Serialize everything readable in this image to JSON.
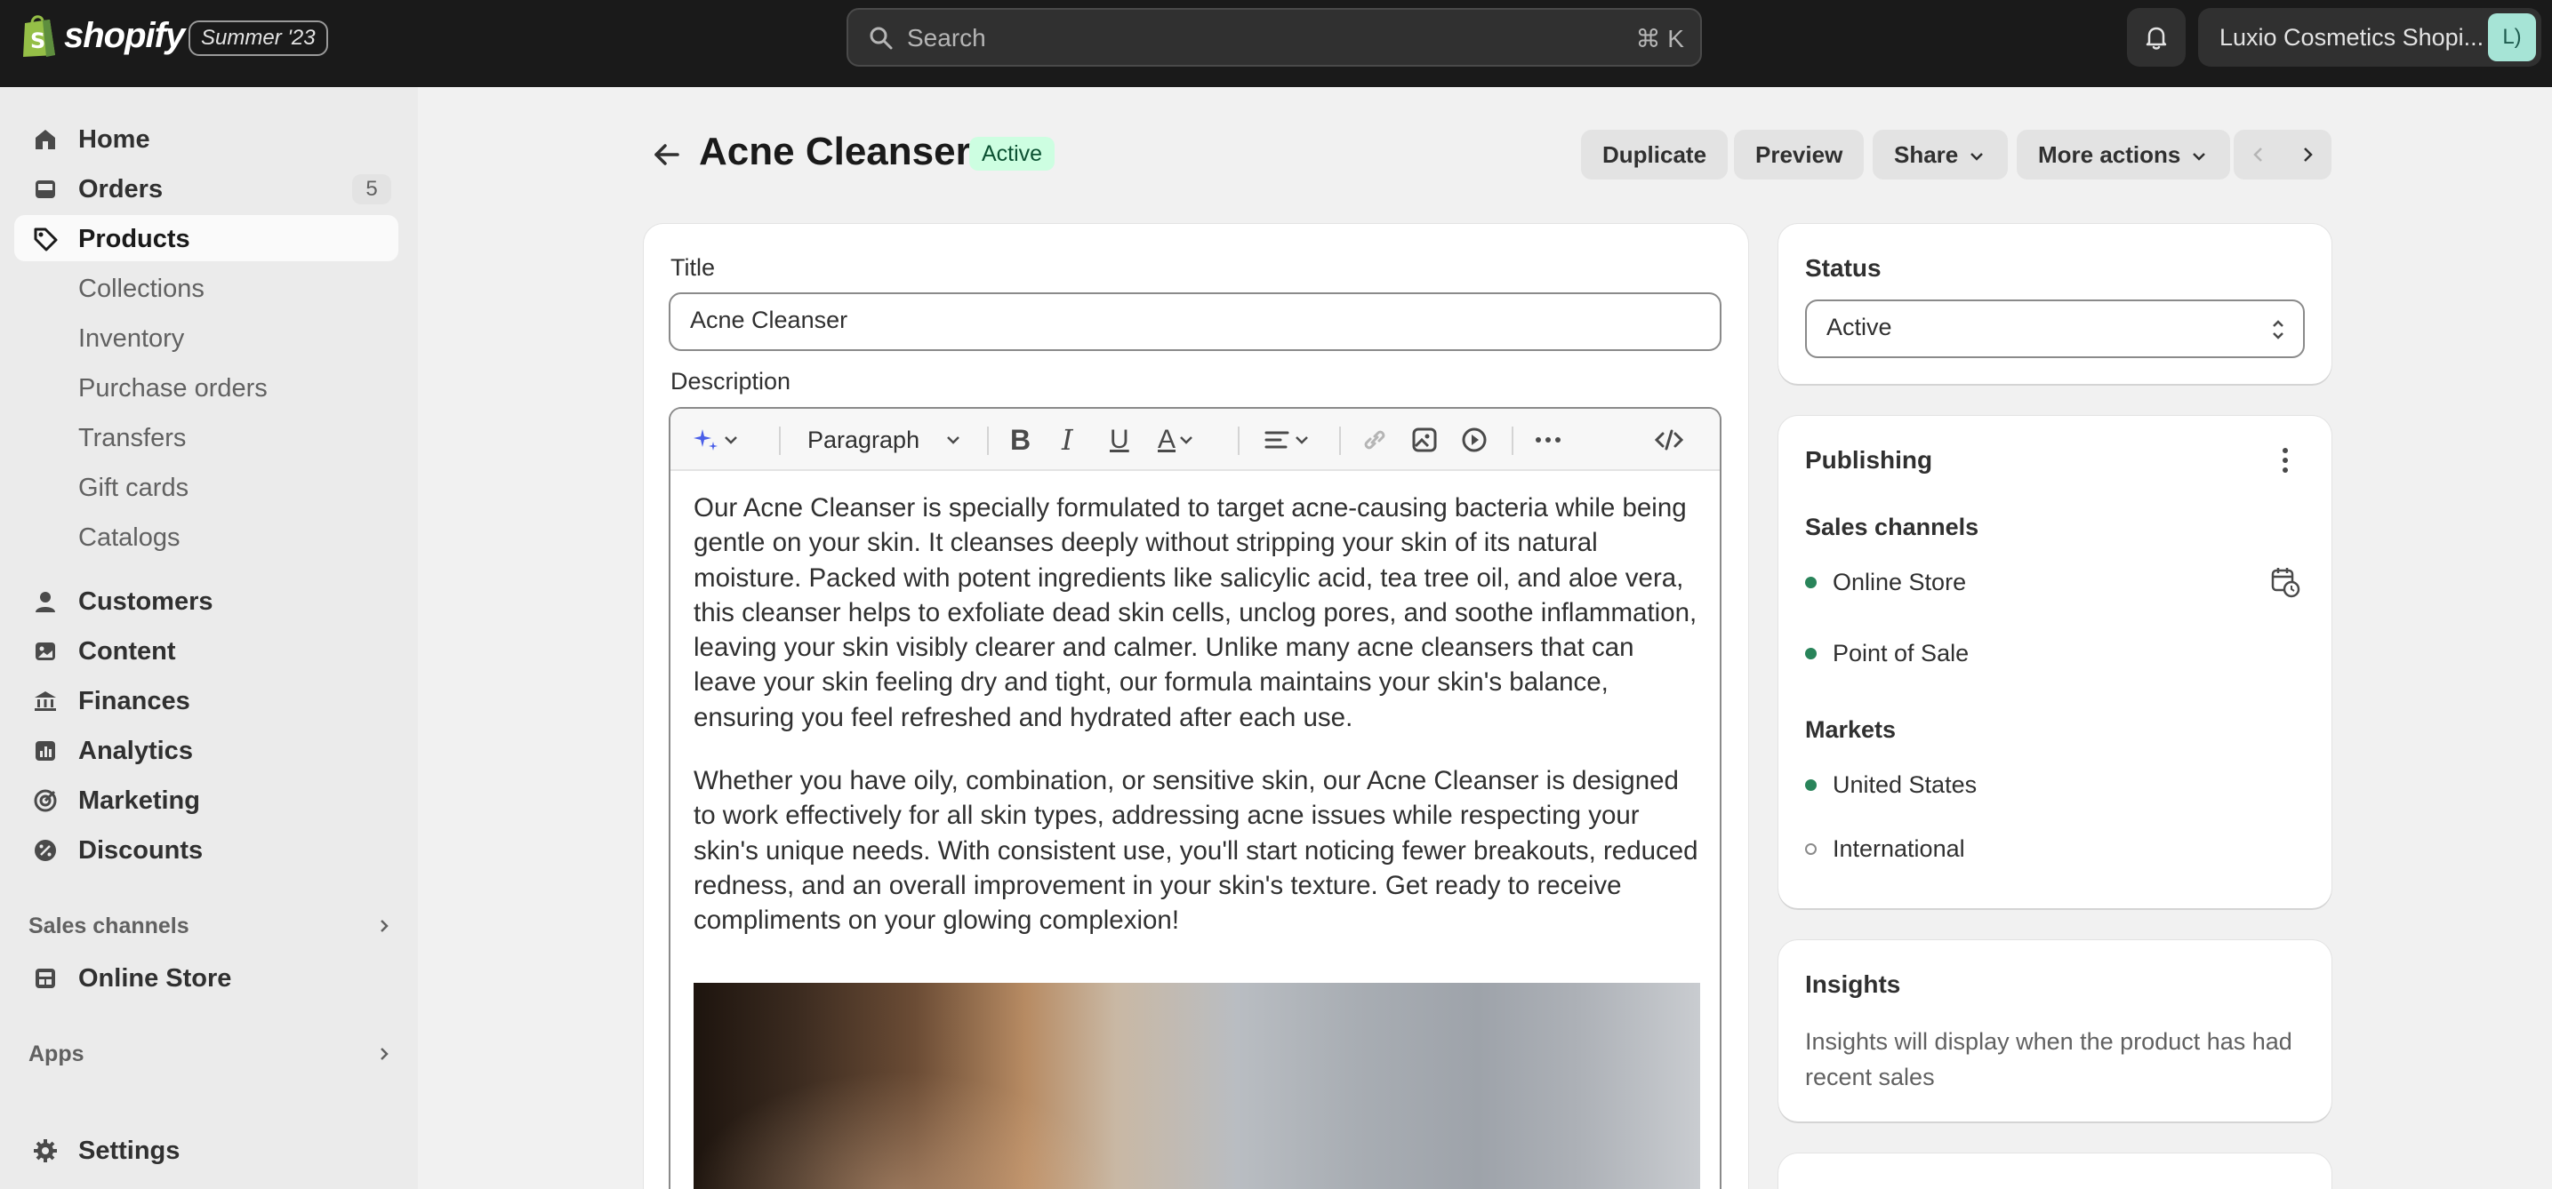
{
  "topbar": {
    "logo_text": "shopify",
    "edition_badge": "Summer '23",
    "search_placeholder": "Search",
    "search_shortcut": "⌘ K",
    "store_name": "Luxio Cosmetics Shopi...",
    "avatar_initials": "L)"
  },
  "sidebar": {
    "items": [
      {
        "label": "Home",
        "icon": "home-icon"
      },
      {
        "label": "Orders",
        "icon": "orders-icon",
        "count": "5"
      },
      {
        "label": "Products",
        "icon": "tag-icon",
        "active": true
      },
      {
        "label": "Collections"
      },
      {
        "label": "Inventory"
      },
      {
        "label": "Purchase orders"
      },
      {
        "label": "Transfers"
      },
      {
        "label": "Gift cards"
      },
      {
        "label": "Catalogs"
      },
      {
        "label": "Customers",
        "icon": "person-icon"
      },
      {
        "label": "Content",
        "icon": "content-icon"
      },
      {
        "label": "Finances",
        "icon": "bank-icon"
      },
      {
        "label": "Analytics",
        "icon": "chart-icon"
      },
      {
        "label": "Marketing",
        "icon": "target-icon"
      },
      {
        "label": "Discounts",
        "icon": "discount-icon"
      }
    ],
    "sales_channels_heading": "Sales channels",
    "online_store": "Online Store",
    "apps_heading": "Apps",
    "settings": "Settings"
  },
  "page": {
    "title": "Acne Cleanser",
    "status": "Active",
    "actions": {
      "duplicate": "Duplicate",
      "preview": "Preview",
      "share": "Share",
      "more": "More actions"
    }
  },
  "product": {
    "title_label": "Title",
    "title_value": "Acne Cleanser",
    "description_label": "Description",
    "format_select": "Paragraph",
    "description_paragraphs": [
      "Our Acne Cleanser is specially formulated to target acne-causing bacteria while being gentle on your skin. It cleanses deeply without stripping your skin of its natural moisture. Packed with potent ingredients like salicylic acid, tea tree oil, and aloe vera, this cleanser helps to exfoliate dead skin cells, unclog pores, and soothe inflammation, leaving your skin visibly clearer and calmer. Unlike many acne cleansers that can leave your skin feeling dry and tight, our formula maintains your skin's balance, ensuring you feel refreshed and hydrated after each use.",
      "Whether you have oily, combination, or sensitive skin, our Acne Cleanser is designed to work effectively for all skin types, addressing acne issues while respecting your skin's unique needs. With consistent use, you'll start noticing fewer breakouts, reduced redness, and an overall improvement in your skin's texture. Get ready to receive compliments on your glowing complexion!"
    ]
  },
  "status_card": {
    "heading": "Status",
    "value": "Active"
  },
  "publishing": {
    "heading": "Publishing",
    "sales_channels_heading": "Sales channels",
    "channels": [
      "Online Store",
      "Point of Sale"
    ],
    "markets_heading": "Markets",
    "markets": [
      "United States",
      "International"
    ]
  },
  "insights": {
    "heading": "Insights",
    "text": "Insights will display when the product has had recent sales"
  },
  "colors": {
    "topbar": "#1a1a1a",
    "active_badge_bg": "#cdfee1",
    "active_badge_text": "#0c5132",
    "channel_dot": "#29845a"
  }
}
